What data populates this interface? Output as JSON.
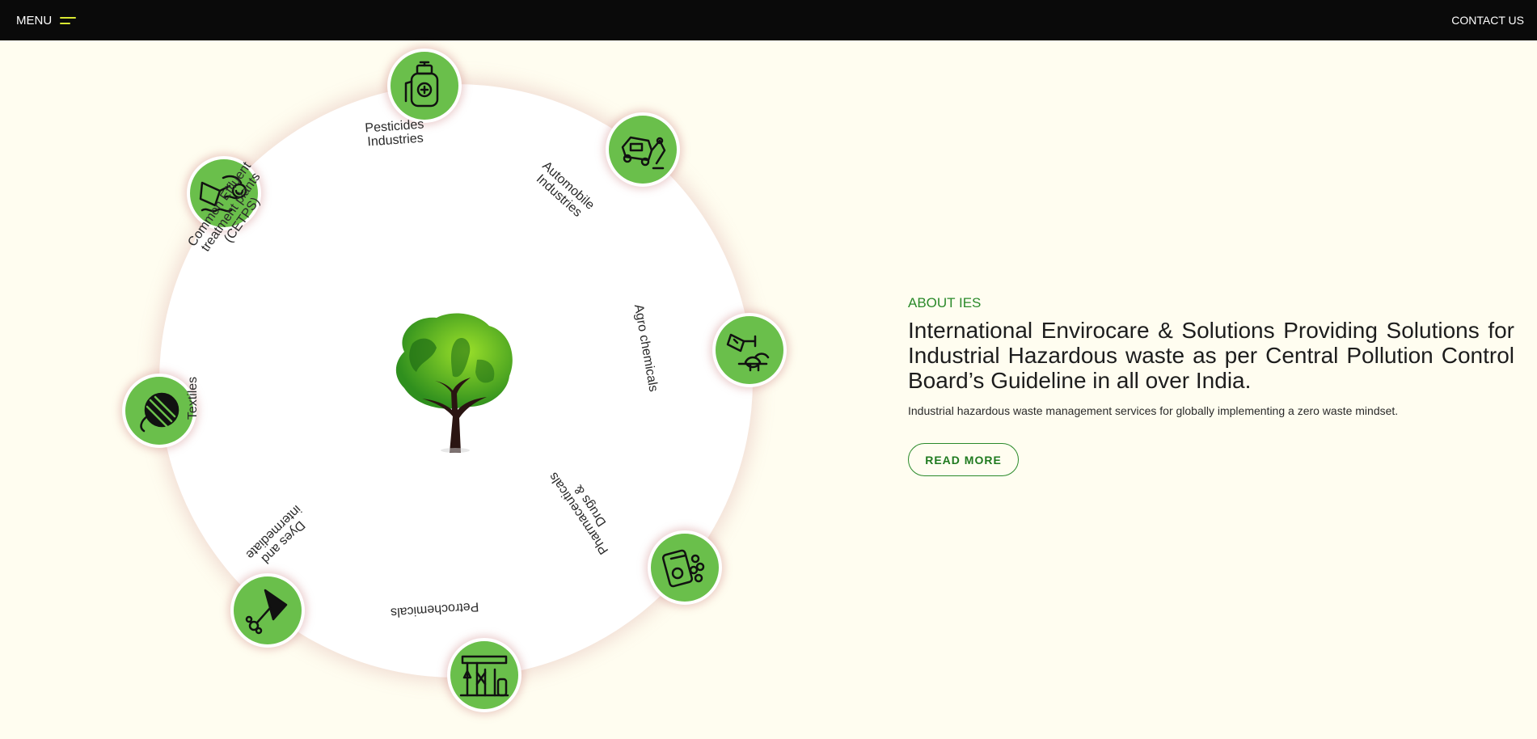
{
  "header": {
    "menu_label": "MENU",
    "contact_label": "CONTACT US",
    "accent_color": "#d9e832"
  },
  "industries": [
    {
      "label_lines": [
        "Pesticides",
        "Industries"
      ],
      "icon": "sprayer-icon"
    },
    {
      "label_lines": [
        "Automobile",
        "Industries"
      ],
      "icon": "car-robot-arm-icon"
    },
    {
      "label_lines": [
        "Agro chemicals"
      ],
      "icon": "flask-wheat-icon"
    },
    {
      "label_lines": [
        "Pharmaceuticals",
        "Drugs &"
      ],
      "icon": "pills-bottle-icon"
    },
    {
      "label_lines": [
        "Petrochemicals"
      ],
      "icon": "refinery-icon"
    },
    {
      "label_lines": [
        "Dyes and",
        "intermediate"
      ],
      "icon": "dye-flask-icon"
    },
    {
      "label_lines": [
        "Textiles"
      ],
      "icon": "yarn-ball-icon"
    },
    {
      "label_lines": [
        "Common Effluent",
        "treatment plants",
        "(CETPS)"
      ],
      "icon": "effluent-plant-icon"
    }
  ],
  "about": {
    "eyebrow": "ABOUT IES",
    "title": "International Envirocare & Solutions Providing Solutions for Industrial Hazardous waste as per Central Pollution Control Board’s Guideline in all over India.",
    "description": "Industrial hazardous waste management services for globally implementing a zero waste mindset.",
    "button_label": "READ MORE"
  },
  "colors": {
    "background": "#fffdf0",
    "topbar": "#0a0a0a",
    "node_green": "#6abf4b",
    "accent_green": "#2a8a2a"
  }
}
